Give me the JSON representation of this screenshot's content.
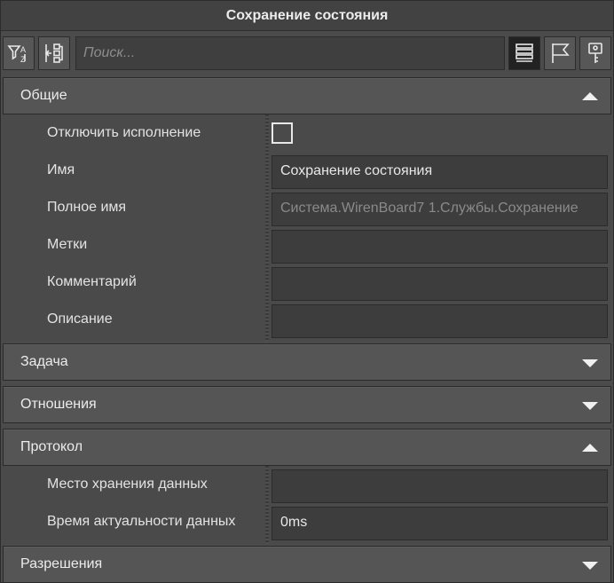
{
  "window": {
    "title": "Сохранение состояния"
  },
  "toolbar": {
    "search_placeholder": "Поиск...",
    "left_buttons": [
      "sort-filter-icon",
      "expand-tree-icon"
    ],
    "right_buttons": [
      "list-view-icon",
      "flag-icon",
      "key-icon"
    ]
  },
  "sections": {
    "general": {
      "title": "Общие",
      "rows": {
        "disable": {
          "label": "Отключить исполнение",
          "checked": false
        },
        "name": {
          "label": "Имя",
          "value": "Сохранение состояния"
        },
        "fullname": {
          "label": "Полное имя",
          "value": "Система.WirenBoard7 1.Службы.Сохранение"
        },
        "tags": {
          "label": "Метки",
          "value": ""
        },
        "comment": {
          "label": "Комментарий",
          "value": ""
        },
        "description": {
          "label": "Описание",
          "value": ""
        }
      }
    },
    "task": {
      "title": "Задача"
    },
    "relations": {
      "title": "Отношения"
    },
    "protocol": {
      "title": "Протокол",
      "rows": {
        "storage": {
          "label": "Место хранения данных",
          "value": ""
        },
        "ttl": {
          "label": "Время актуальности данных",
          "value": "0ms"
        }
      }
    },
    "permissions": {
      "title": "Разрешения"
    }
  },
  "colors": {
    "panel": "#4b4b4b",
    "header": "#555555",
    "field": "#3d3d3d",
    "text": "#e6e6e6"
  }
}
